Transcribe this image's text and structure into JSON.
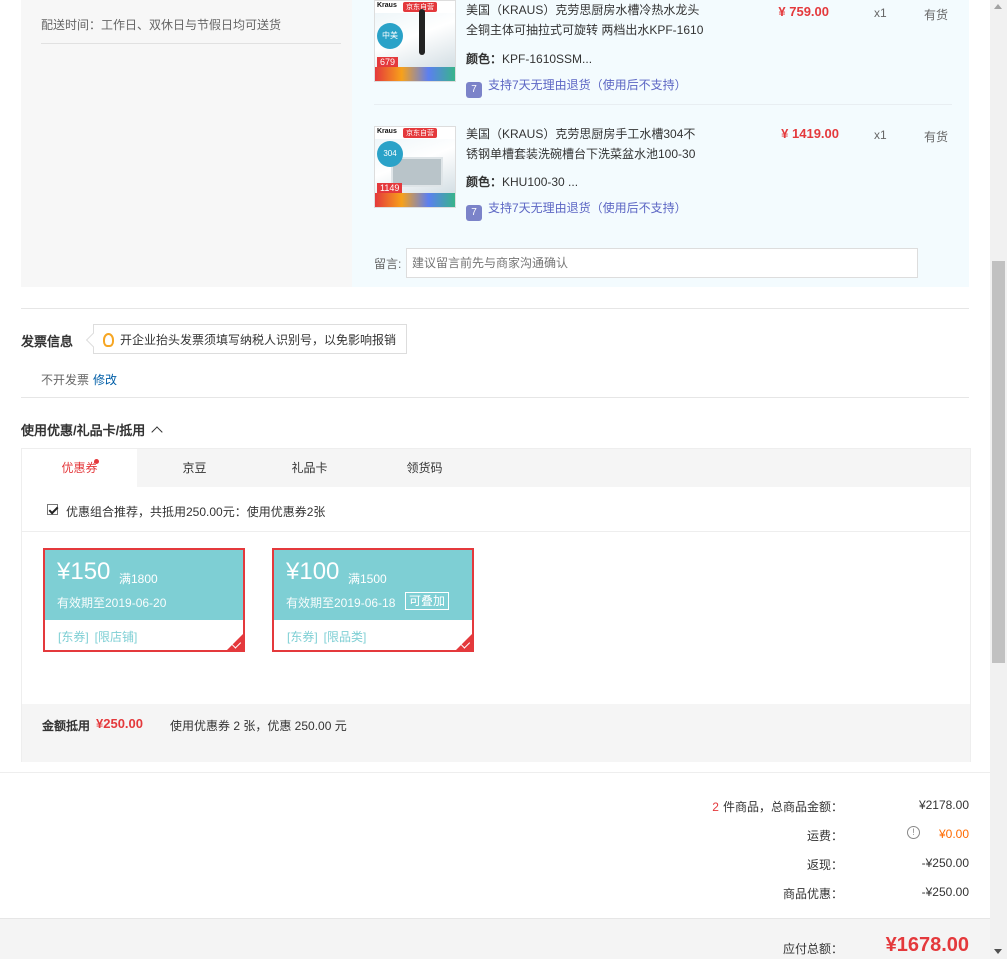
{
  "delivery": {
    "text": "配送时间：工作日、双休日与节假日均可送货"
  },
  "goods": [
    {
      "name": "美国（KRAUS）克劳思厨房水槽冷热水龙头全铜主体可抽拉式可旋转 两档出水KPF-1610",
      "color_label": "颜色：",
      "color_value": "KPF-1610SSM...",
      "return_policy": "支持7天无理由退货（使用后不支持）",
      "price": "¥ 759.00",
      "qty": "x1",
      "stock": "有货",
      "thumb": {
        "brand": "Kraus",
        "tag": "京东自营",
        "badge": "中美",
        "price": "679"
      }
    },
    {
      "name": "美国（KRAUS）克劳思厨房手工水槽304不锈钢单槽套装洗碗槽台下洗菜盆水池100-30",
      "color_label": "颜色：",
      "color_value": "KHU100-30 ...",
      "return_policy": "支持7天无理由退货（使用后不支持）",
      "price": "¥ 1419.00",
      "qty": "x1",
      "stock": "有货",
      "thumb": {
        "brand": "Kraus",
        "tag": "京东自营",
        "badge": "304",
        "price": "1149"
      }
    }
  ],
  "message": {
    "label": "留言:",
    "placeholder": "建议留言前先与商家沟通确认"
  },
  "invoice": {
    "title": "发票信息",
    "tip": "开企业抬头发票须填写纳税人识别号，以免影响报销",
    "status": "不开发票",
    "edit_link": "修改"
  },
  "coupons": {
    "title": "使用优惠/礼品卡/抵用",
    "tabs": [
      "优惠券",
      "京豆",
      "礼品卡",
      "领货码"
    ],
    "recommend_text": "优惠组合推荐，共抵用250.00元：使用优惠券2张",
    "list": [
      {
        "amount": "¥150",
        "condition": "满1800",
        "expiry": "有效期至2019-06-20",
        "stackable": "",
        "tags": [
          "[东券]",
          "[限店铺]"
        ]
      },
      {
        "amount": "¥100",
        "condition": "满1500",
        "expiry": "有效期至2019-06-18",
        "stackable": "可叠加",
        "tags": [
          "[东券]",
          "[限品类]"
        ]
      }
    ],
    "summary": {
      "label": "金额抵用",
      "amount": "¥250.00",
      "desc": "使用优惠券 2 张，优惠 250.00 元"
    }
  },
  "totals": {
    "item_count": "2",
    "items_label": "件商品，总商品金额：",
    "items_value": "¥2178.00",
    "shipping_label": "运费：",
    "shipping_value": "¥0.00",
    "rebate_label": "返现：",
    "rebate_value": "-¥250.00",
    "discount_label": "商品优惠：",
    "discount_value": "-¥250.00",
    "payable_label": "应付总额：",
    "payable_value": "¥1678.00"
  },
  "colors": {
    "accent_red": "#e4393c",
    "coupon_teal": "#7ecfd4",
    "link_blue": "#005ea7",
    "return_purple": "#5c66c4"
  }
}
